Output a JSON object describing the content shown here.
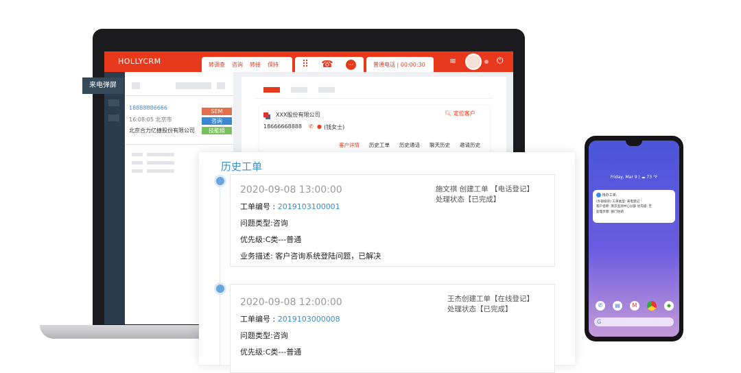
{
  "app": {
    "title": "HOLLYCRM",
    "call_actions": [
      "转调查",
      "咨询",
      "转接",
      "保持"
    ],
    "call_status": "普通电话 | 00:00:30",
    "popup_label": "来电弹屏"
  },
  "contact_list": {
    "phone": "18888886666",
    "time_city": "16:08:05  北京市",
    "company": "北京合力亿捷股份有限公司",
    "tags": [
      {
        "label": "SEM",
        "color": "#e2704f"
      },
      {
        "label": "咨询",
        "color": "#3b86d0"
      },
      {
        "label": "技能组",
        "color": "#7ac05a"
      }
    ]
  },
  "customer": {
    "company": "XXX股份有限公司",
    "phone": "18666668888",
    "name": "(钱女士)",
    "locate": "定位客户",
    "tabs": [
      "客户详情",
      "历史工单",
      "历史通话",
      "聊天历史",
      "邀请历史"
    ]
  },
  "history": {
    "title": "历史工单",
    "items": [
      {
        "datetime": "2020-09-08 13:00:00",
        "id_label": "工单编号 : ",
        "id": "2019103100001",
        "type": "问题类型:咨询",
        "priority": "优先级:C类---普通",
        "desc": "业务描述:  客户咨询系统登陆问题，已解决",
        "creator": "施文祺 创建工单 【电话登记】",
        "status": "处理状态【已完成】"
      },
      {
        "datetime": "2020-09-08 12:00:00",
        "id_label": "工单编号 : ",
        "id": "2019103000008",
        "type": "问题类型:咨询",
        "priority": "优先级:C类---普通",
        "creator": "王杰创建工单【在线登记】",
        "status": "处理状态【已完成】"
      }
    ]
  },
  "phone": {
    "date_weather": "Friday, Mar 9  |  ☁ 73 °F",
    "notif_title": "待办工单:",
    "notif_lines": [
      "(外部投诉) 工单类型:  来电登记",
      "客户名称:  南京监测中心分部    优先级: 无",
      "处理步骤:  部门协调"
    ]
  }
}
